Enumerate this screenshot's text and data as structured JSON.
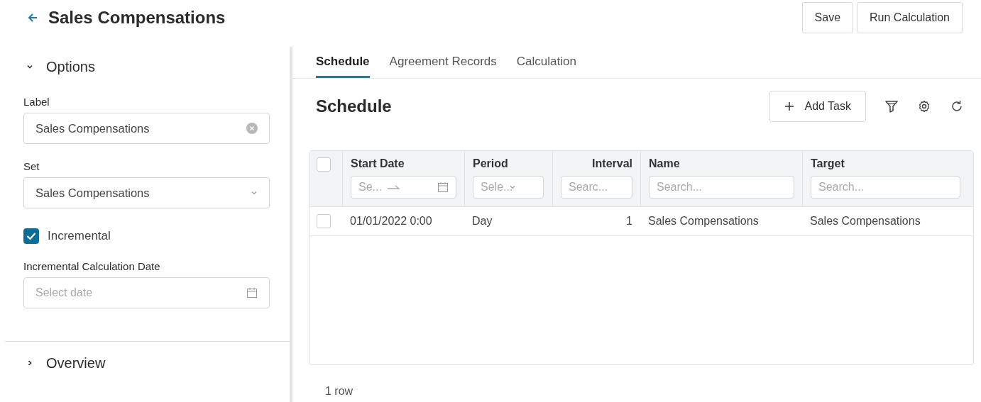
{
  "header": {
    "title": "Sales Compensations",
    "buttons": [
      "Save",
      "Run Calculation"
    ]
  },
  "sidebar": {
    "sections": [
      {
        "title": "Options",
        "expanded": true,
        "fields": [
          {
            "kind": "text",
            "label": "Label",
            "value": "Sales Compensations"
          },
          {
            "kind": "select",
            "label": "Set",
            "value": "Sales Compensations"
          },
          {
            "kind": "checkbox",
            "label": "Incremental",
            "checked": true
          },
          {
            "kind": "date",
            "label": "Incremental Calculation Date",
            "placeholder": "Select date"
          }
        ]
      },
      {
        "title": "Overview",
        "expanded": false
      }
    ]
  },
  "tabs": [
    {
      "label": "Schedule",
      "selected": true
    },
    {
      "label": "Agreement Records",
      "selected": false
    },
    {
      "label": "Calculation",
      "selected": false
    }
  ],
  "panel": {
    "title": "Schedule",
    "add_button": "Add Task"
  },
  "table": {
    "select_all": {
      "checked": false
    },
    "columns": [
      {
        "label": "Start Date",
        "kind": "daterange",
        "placeholder": "Se..."
      },
      {
        "label": "Period",
        "kind": "select",
        "placeholder": "Sele..."
      },
      {
        "label": "Interval",
        "kind": "number",
        "placeholder": "Searc..."
      },
      {
        "label": "Name",
        "kind": "text",
        "placeholder": "Search..."
      },
      {
        "label": "Target",
        "kind": "text",
        "placeholder": "Search..."
      }
    ],
    "rows": [
      {
        "checked": false,
        "cells": [
          "01/01/2022 0:00",
          "Day",
          "1",
          "Sales Compensations",
          "Sales Compensations"
        ]
      }
    ]
  },
  "footer": {
    "count": "1 row"
  }
}
